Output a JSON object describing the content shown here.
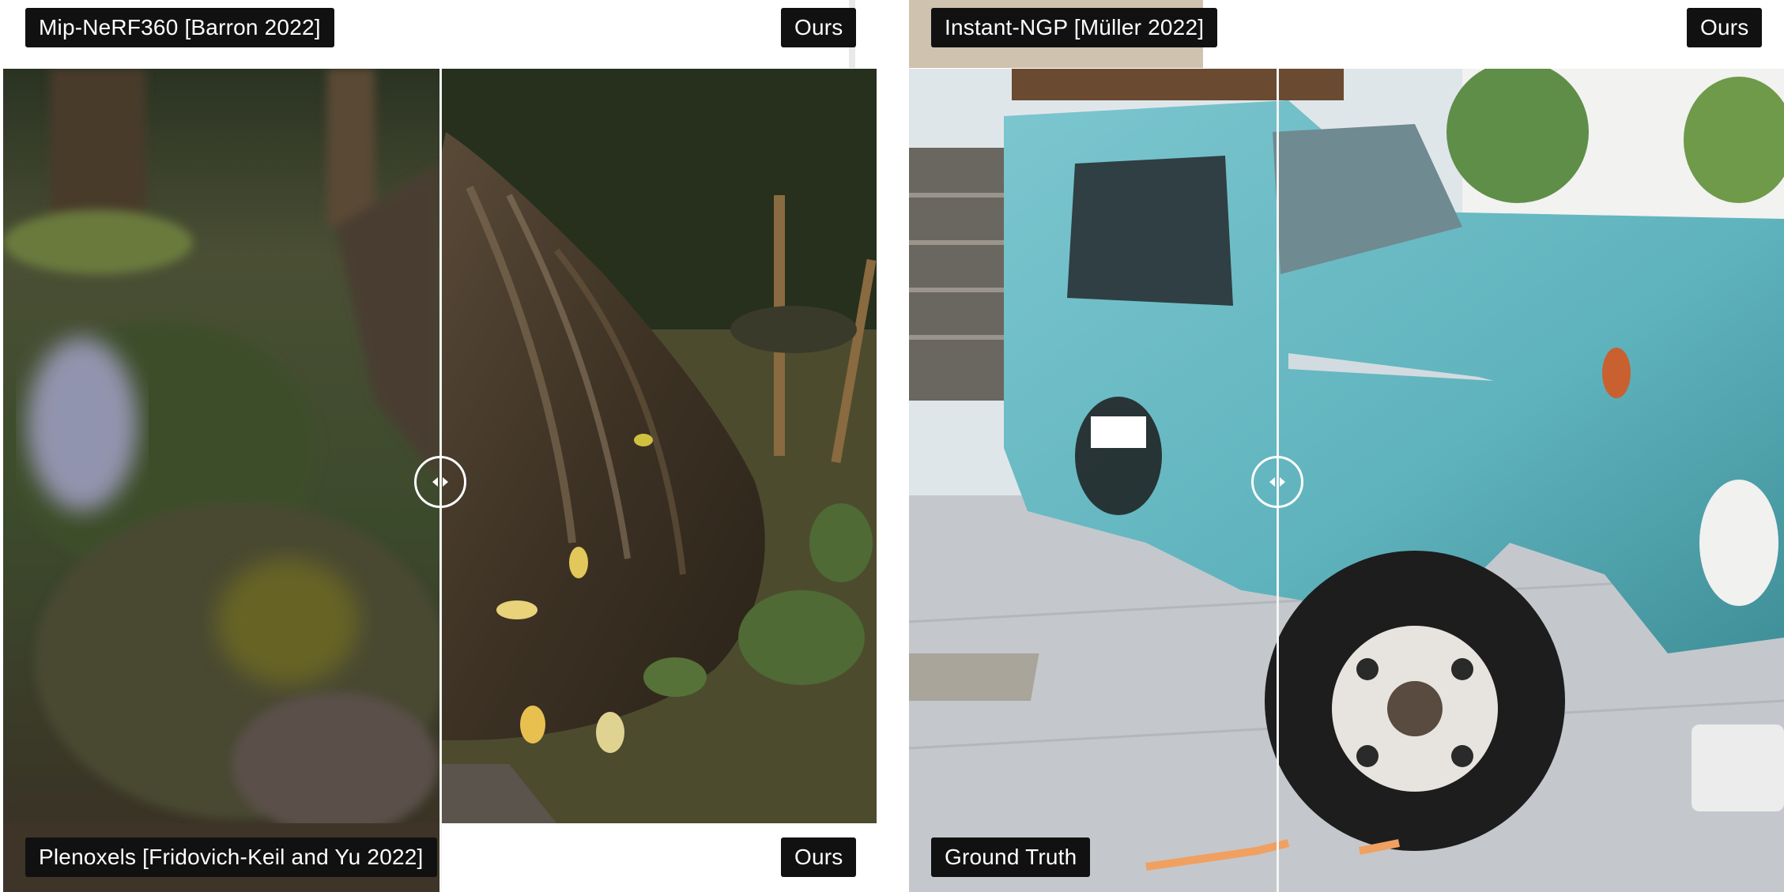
{
  "left_comparison": {
    "top_method_label": "Mip-NeRF360 [Barron 2022]",
    "top_ours_label": "Ours",
    "bottom_method_label": "Plenoxels [Fridovich-Keil and Yu 2022]",
    "bottom_ours_label": "Ours",
    "scene": "forest-stump",
    "slider_position": 0.5
  },
  "right_comparison": {
    "top_method_label": "Instant-NGP [Müller 2022]",
    "top_ours_label": "Ours",
    "bottom_method_label": "Ground Truth",
    "scene": "truck",
    "slider_position": 0.42
  },
  "colors": {
    "label_bg": "#111111",
    "label_text": "#ffffff",
    "divider": "#f4f4f4",
    "truck": "#5fb3bd",
    "forest_ground": "#4d4b2e",
    "sky": "#dfe6ea"
  },
  "icons": [
    "left-arrow-icon",
    "right-arrow-icon"
  ]
}
